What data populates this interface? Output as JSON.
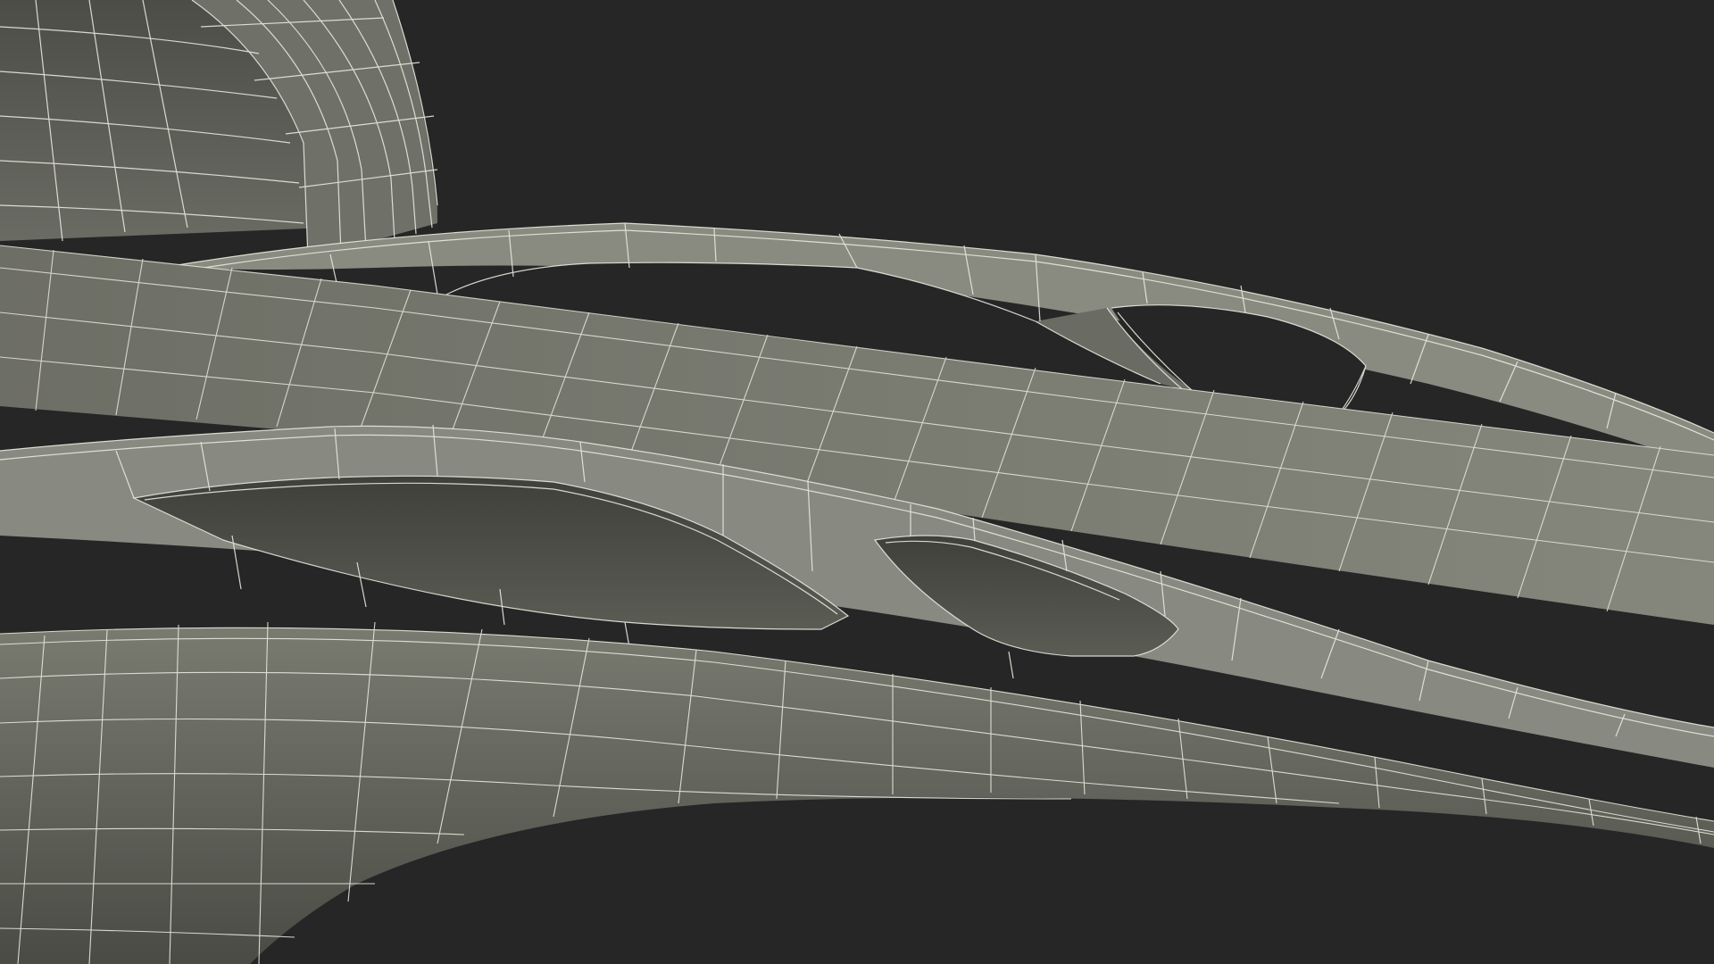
{
  "render": {
    "background_color": "#262626",
    "surface_color": "#7d7e74",
    "surface_dark_color": "#55564e",
    "wire_color": "#e9e8df"
  }
}
